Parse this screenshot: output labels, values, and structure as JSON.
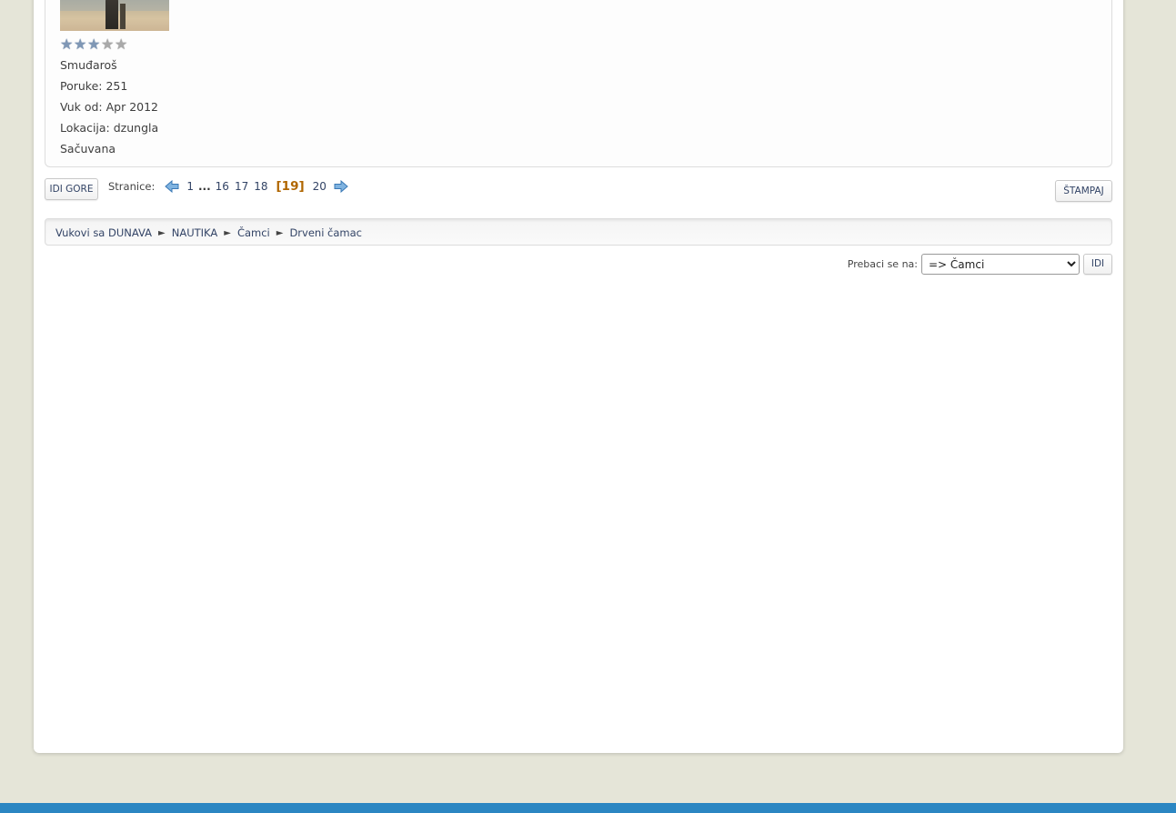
{
  "profile": {
    "avatar_alt": "avatar",
    "rank": "Smuđaroš",
    "posts": "Poruke: 251",
    "member_since": "Vuk od: Apr 2012",
    "location": "Lokacija: dzungla",
    "status": "Sačuvana",
    "stars_filled": 3,
    "stars_total": 5
  },
  "toolbar": {
    "go_up_label": "IDI GORE",
    "print_label": "ŠTAMPAJ"
  },
  "pagination": {
    "label": "Stranice:",
    "first": "1",
    "dots": "...",
    "pages": [
      "16",
      "17",
      "18"
    ],
    "current": "[19]",
    "next": "20"
  },
  "breadcrumb": {
    "items": [
      "Vukovi sa DUNAVA",
      "NAUTIKA",
      "Čamci",
      "Drveni čamac"
    ],
    "separator": "►"
  },
  "jump": {
    "label": "Prebaci se na:",
    "selected": "=> Čamci",
    "go_label": "IDI"
  },
  "colors": {
    "background": "#e5e5d8",
    "link": "#334466",
    "current_page": "#b06600",
    "footer": "#2b86c2"
  }
}
